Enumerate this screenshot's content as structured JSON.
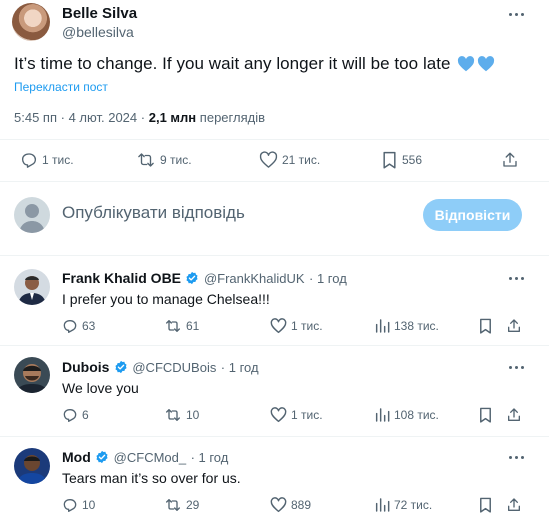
{
  "tweet": {
    "author_name": "Belle Silva",
    "author_handle": "@bellesilva",
    "text": "It’s time to change. If you wait any longer it will be too late",
    "emoji": "💙💙",
    "translate_label": "Перекласти пост",
    "time": "5:45 пп",
    "separator": "·",
    "date": "4 лют. 2024",
    "views_count": "2,1 млн",
    "views_label": "переглядів",
    "stats": {
      "replies": "1 тис.",
      "reposts": "9 тис.",
      "likes": "21 тис.",
      "bookmarks": "556"
    }
  },
  "composer": {
    "placeholder": "Опублікувати відповідь",
    "reply_button": "Відповісти"
  },
  "replies": [
    {
      "name": "Frank Khalid OBE",
      "handle": "@FrankKhalidUK",
      "time": "· 1 год",
      "text": "I prefer you to manage Chelsea!!!",
      "replies": "63",
      "reposts": "61",
      "likes": "1 тис.",
      "views": "138 тис."
    },
    {
      "name": "Dubois",
      "handle": "@CFCDUBois",
      "time": "· 1 год",
      "text": "We love you",
      "replies": "6",
      "reposts": "10",
      "likes": "1 тис.",
      "views": "108 тис."
    },
    {
      "name": "Mod",
      "handle": "@CFCMod_",
      "time": "· 1 год",
      "text": "Tears man it’s so over for us.",
      "replies": "10",
      "reposts": "29",
      "likes": "889",
      "views": "72 тис."
    }
  ],
  "colors": {
    "accent": "#1d9bf0",
    "muted": "#536471",
    "text": "#0f1419",
    "divider": "#eff3f4",
    "reply_button_disabled": "#8ecdf8",
    "heart_emoji": "#5dadec"
  },
  "icons": [
    "more-icon",
    "reply-icon",
    "repost-icon",
    "like-icon",
    "bookmark-icon",
    "share-icon",
    "views-icon",
    "verified-icon",
    "blue-heart-icon"
  ]
}
